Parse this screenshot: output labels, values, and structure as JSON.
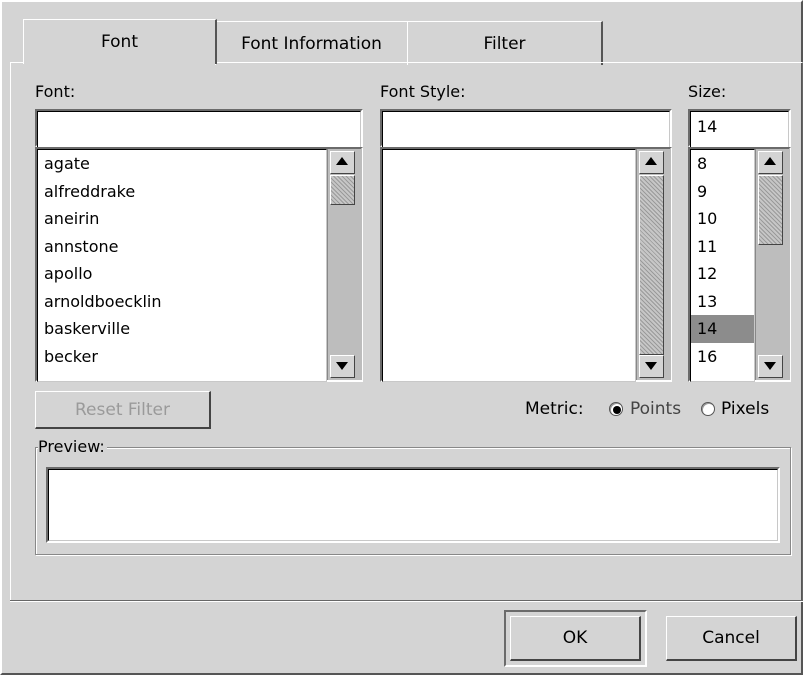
{
  "tabs": [
    {
      "label": "Font"
    },
    {
      "label": "Font Information"
    },
    {
      "label": "Filter"
    }
  ],
  "font_panel": {
    "label": "Font:",
    "input_value": "",
    "items": [
      "agate",
      "alfreddrake",
      "aneirin",
      "annstone",
      "apollo",
      "arnoldboecklin",
      "baskerville",
      "becker"
    ]
  },
  "style_panel": {
    "label": "Font Style:",
    "input_value": "",
    "items": []
  },
  "size_panel": {
    "label": "Size:",
    "input_value": "14",
    "items": [
      "8",
      "9",
      "10",
      "11",
      "12",
      "13",
      "14",
      "16"
    ],
    "selected": "14"
  },
  "reset_filter_label": "Reset Filter",
  "metric": {
    "label": "Metric:",
    "options": [
      {
        "label": "Points",
        "checked": true
      },
      {
        "label": "Pixels",
        "checked": false
      }
    ]
  },
  "preview": {
    "label": "Preview:",
    "text": ""
  },
  "buttons": {
    "ok": "OK",
    "cancel": "Cancel"
  },
  "icons": {
    "scroll_up": "arrow-up-icon",
    "scroll_down": "arrow-down-icon"
  }
}
